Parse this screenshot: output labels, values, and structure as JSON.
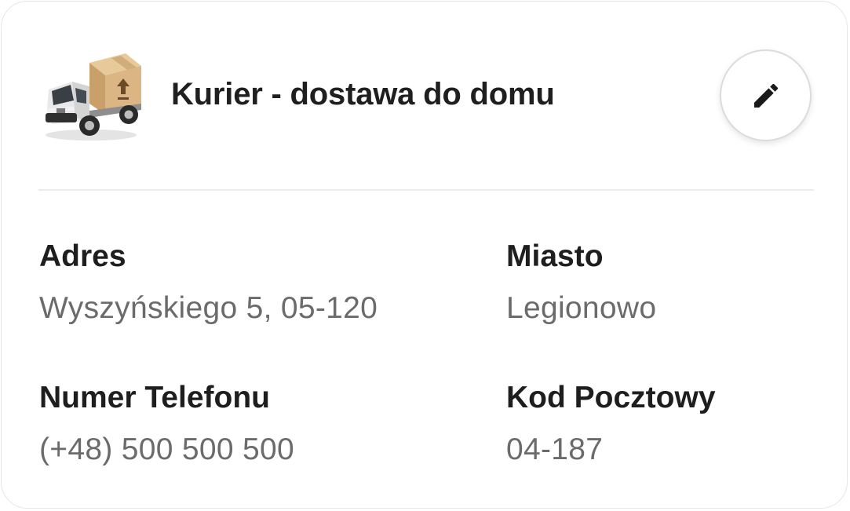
{
  "delivery": {
    "title": "Kurier - dostawa do domu",
    "icon": "delivery-truck-icon",
    "edit_icon": "pencil-icon"
  },
  "fields": {
    "address": {
      "label": "Adres",
      "value": "Wyszyńskiego 5, 05-120"
    },
    "city": {
      "label": "Miasto",
      "value": "Legionowo"
    },
    "phone": {
      "label": "Numer Telefonu",
      "value": "(+48) 500 500 500"
    },
    "postal_code": {
      "label": "Kod Pocztowy",
      "value": "04-187"
    }
  },
  "colors": {
    "text_primary": "#1e1e1e",
    "text_secondary": "#6b6b6b",
    "border": "#e6e6e6"
  }
}
